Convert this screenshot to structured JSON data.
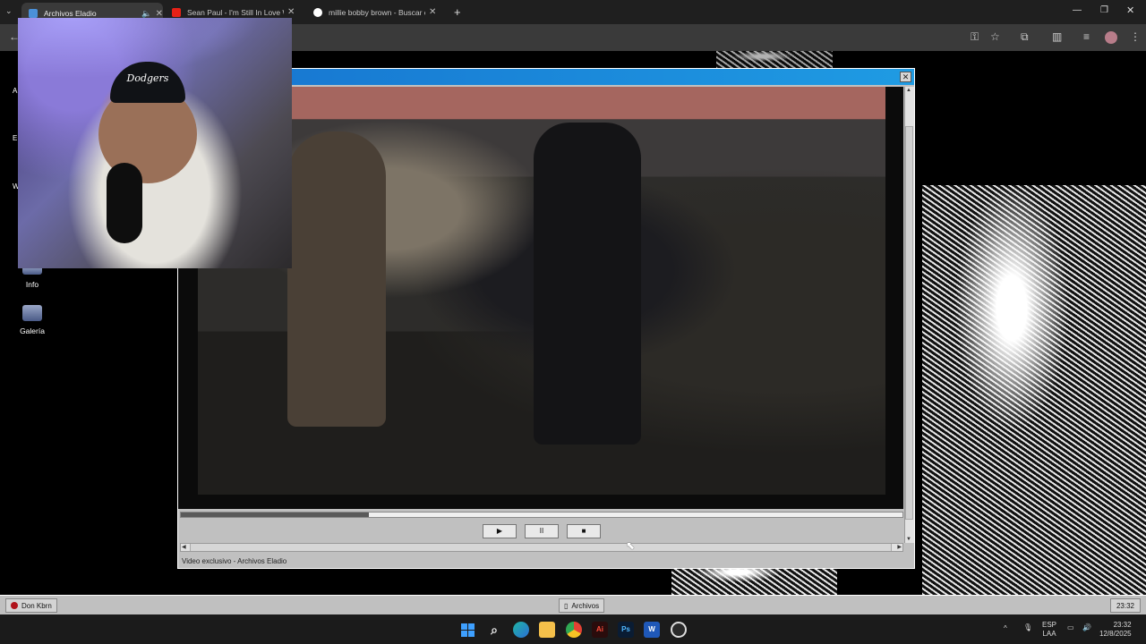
{
  "browser": {
    "tabs": [
      {
        "title": "Archivos Eladio",
        "active": true
      },
      {
        "title": "Sean Paul - I'm Still In Love Wit",
        "active": false
      },
      {
        "title": "millie bobby brown - Buscar co",
        "active": false
      }
    ],
    "new_tab_glyph": "+",
    "tab_close_glyph": "✕"
  },
  "desktop": {
    "icons": [
      {
        "label": "Info"
      },
      {
        "label": "Galería"
      }
    ],
    "side_letters": [
      "A",
      "E",
      "W"
    ]
  },
  "player": {
    "close_glyph": "✕",
    "controls": {
      "play": "▶",
      "pause": "II",
      "stop": "■"
    },
    "progress": 0.26,
    "status": "Video exclusivo - Archivos Eladio"
  },
  "webcam": {
    "cap_text": "Dodgers"
  },
  "app_taskbar": {
    "left_button": "Don Kbrn",
    "center_button": "Archivos",
    "clock": "23:32"
  },
  "windows_taskbar": {
    "apps": [
      "start",
      "search",
      "edge",
      "explorer",
      "chrome",
      "acrobat",
      "photoshop",
      "word",
      "obs"
    ],
    "lang_top": "ESP",
    "lang_bottom": "LAA",
    "time": "23:32",
    "date": "12/8/2025"
  },
  "colors": {
    "titlebar": "#1673cf",
    "window_gray": "#c0c0c0"
  }
}
